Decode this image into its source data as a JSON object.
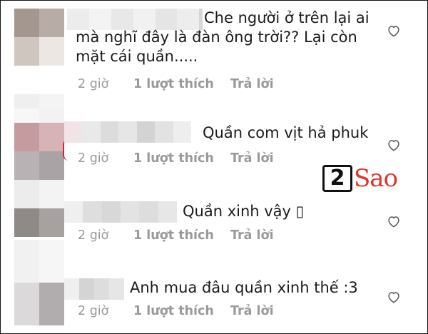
{
  "comments": [
    {
      "text": "Che người ở trên lại ai\nmà nghĩ đây là đàn ông trời?? Lại còn\nmặt cái quần.....",
      "time": "2 giờ",
      "likes": "1 lượt thích",
      "reply": "Trả lời"
    },
    {
      "text": "Quần com vịt hả phuk",
      "time": "2 giờ",
      "likes": "1 lượt thích",
      "reply": "Trả lời"
    },
    {
      "text": "Quần xinh vậy ▯",
      "time": "2 giờ",
      "likes": "1 lượt thích",
      "reply": "Trả lời"
    },
    {
      "text": "Anh mua đâu quần xinh thế :3",
      "time": "2 giờ",
      "likes": "1 lượt thích",
      "reply": "Trả lời"
    }
  ],
  "watermark": {
    "digit": "2",
    "word": "Sao",
    "accent_color": "#e1342b"
  },
  "icons": {
    "like": "heart-outline-icon"
  }
}
